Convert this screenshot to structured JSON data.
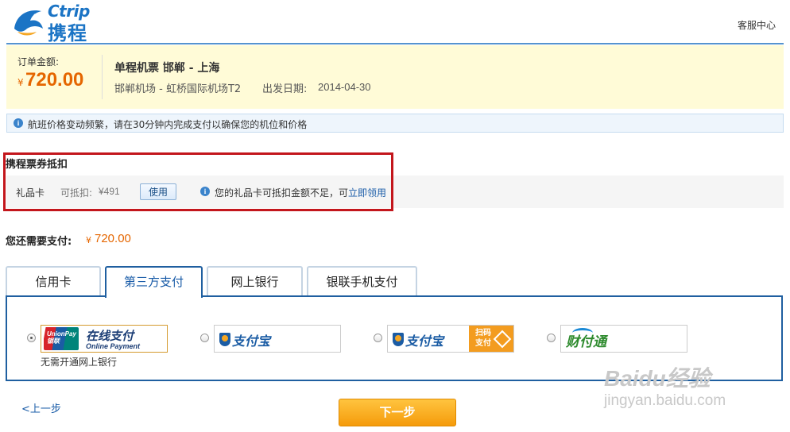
{
  "header": {
    "logo_text": "Ctrip",
    "logo_cn": "携程",
    "service_link": "客服中心"
  },
  "order": {
    "amount_label": "订单金额:",
    "currency": "¥",
    "amount": "720.00",
    "flight_title": "单程机票  邯郸 - 上海",
    "route": "邯郸机场 - 虹桥国际机场T2",
    "date_label": "出发日期:",
    "date": "2014-04-30"
  },
  "notice": {
    "icon": "info-icon",
    "text": "航班价格变动频繁，请在30分钟内完成支付以确保您的机位和价格"
  },
  "voucher": {
    "title": "携程票券抵扣",
    "gift_card_label": "礼品卡",
    "deduct_label": "可抵扣:",
    "deduct_value": "¥491",
    "use_button": "使用",
    "tip_text": "您的礼品卡可抵扣金额不足，可",
    "tip_link": "立即领用"
  },
  "remaining": {
    "label": "您还需要支付:",
    "currency": "¥",
    "amount": "720.00"
  },
  "tabs": [
    {
      "label": "信用卡",
      "active": false
    },
    {
      "label": "第三方支付",
      "active": true
    },
    {
      "label": "网上银行",
      "active": false
    },
    {
      "label": "银联手机支付",
      "active": false
    }
  ],
  "payment_options": {
    "unionpay": {
      "logo_text": "UnionPay 银联",
      "title": "在线支付",
      "subtitle": "Online Payment",
      "caption": "无需开通网上银行",
      "checked": true
    },
    "alipay": {
      "logo_text": "支付宝",
      "checked": false
    },
    "alipay_scan": {
      "logo_text": "支付宝",
      "badge_text": "扫码支付",
      "checked": false
    },
    "tenpay": {
      "logo_text": "财付通",
      "checked": false
    }
  },
  "footer": {
    "prev_link": "<上一步",
    "next_button": "下一步"
  },
  "watermark": {
    "text": "Baidu经验",
    "url": "jingyan.baidu.com"
  },
  "colors": {
    "brand": "#1b74c5",
    "price": "#e56600",
    "voucher_frame": "#c3161c",
    "next_button": "#f7a51c"
  }
}
